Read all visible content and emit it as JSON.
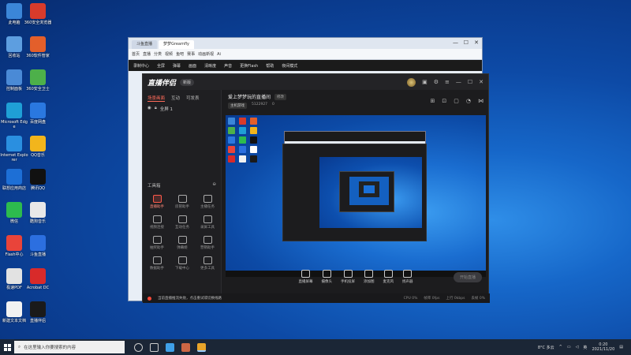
{
  "desktop": {
    "icons": [
      {
        "label": "此电脑",
        "color": "#3b86d8"
      },
      {
        "label": "360安全浏览器",
        "color": "#d83b2b"
      },
      {
        "label": "回收站",
        "color": "#5d9ee0"
      },
      {
        "label": "360软件管家",
        "color": "#e35f2b"
      },
      {
        "label": "控制面板",
        "color": "#4a8ad6"
      },
      {
        "label": "360安全卫士",
        "color": "#4db04a"
      },
      {
        "label": "Microsoft Edge",
        "color": "#1f9fd6"
      },
      {
        "label": "百度网盘",
        "color": "#2a78e0"
      },
      {
        "label": "Internet Explorer",
        "color": "#2a8fe0"
      },
      {
        "label": "QQ音乐",
        "color": "#f2b51c"
      },
      {
        "label": "联想应用商店",
        "color": "#1d6fd6"
      },
      {
        "label": "腾讯QQ",
        "color": "#111"
      },
      {
        "label": "微信",
        "color": "#2dbb4e"
      },
      {
        "label": "酷狗音乐",
        "color": "#e8e8e8"
      },
      {
        "label": "Flash中心",
        "color": "#e9443a"
      },
      {
        "label": "斗鱼直播",
        "color": "#2c6fe0"
      },
      {
        "label": "极速PDF",
        "color": "#e2e2e2"
      },
      {
        "label": "Acrobat DC",
        "color": "#d82a2a"
      },
      {
        "label": "新建文本文档",
        "color": "#f2f2f2"
      },
      {
        "label": "直播伴侣",
        "color": "#1a1a1a"
      }
    ]
  },
  "back_window": {
    "tabs": [
      "斗鱼直播",
      "梦梦Greamfly"
    ],
    "nav": [
      "首页",
      "直播",
      "分类",
      "视频",
      "鱼吧",
      "赛事",
      "动画新视",
      "Ai"
    ],
    "toolbar": [
      "录制中心",
      "全屏",
      "弹幕",
      "画面",
      "清晰度",
      "声音",
      "更换Flash",
      "帮助",
      "夜间模式"
    ]
  },
  "app": {
    "title": "直播伴侣",
    "badge": "新版",
    "window_controls": [
      "—",
      "☐",
      "✕"
    ],
    "sidebar": {
      "tabs": [
        "场景画面",
        "互动",
        "可发表"
      ],
      "scene_label": "全屏 1",
      "tools_title": "工具箱",
      "tools": [
        {
          "label": "直播助手",
          "active": true
        },
        {
          "label": "房管助手",
          "active": false
        },
        {
          "label": "主播任务",
          "active": false
        },
        {
          "label": "视频连接",
          "active": false
        },
        {
          "label": "互动任务",
          "active": false
        },
        {
          "label": "录屏工具",
          "active": false
        },
        {
          "label": "抽奖助手",
          "active": false
        },
        {
          "label": "弹幕姬",
          "active": false
        },
        {
          "label": "营销助手",
          "active": false
        },
        {
          "label": "数据助手",
          "active": false
        },
        {
          "label": "下载中心",
          "active": false
        },
        {
          "label": "更多工具",
          "active": false
        }
      ]
    },
    "room": {
      "title": "爱上梦梦玩的直播间",
      "edit": "修改",
      "category": "主机游戏",
      "room_id": "5122927",
      "hot": "0"
    },
    "controls": [
      "直播屏幕",
      "摄像头",
      "手机投屏",
      "添加图",
      "麦克风",
      "扬声器"
    ],
    "go_live": "开始直播",
    "status": {
      "warning": "当前直播推流失败，点击重试或切换线路",
      "metrics": [
        "CPU 0%",
        "帧率 0fps",
        "上行 0kbps",
        "丢帧 0%"
      ]
    }
  },
  "taskbar": {
    "search_placeholder": "在这里输入你要搜索的内容",
    "weather": "8°C 多云",
    "time": "0:20",
    "date": "2021/11/20",
    "lang": "英"
  }
}
